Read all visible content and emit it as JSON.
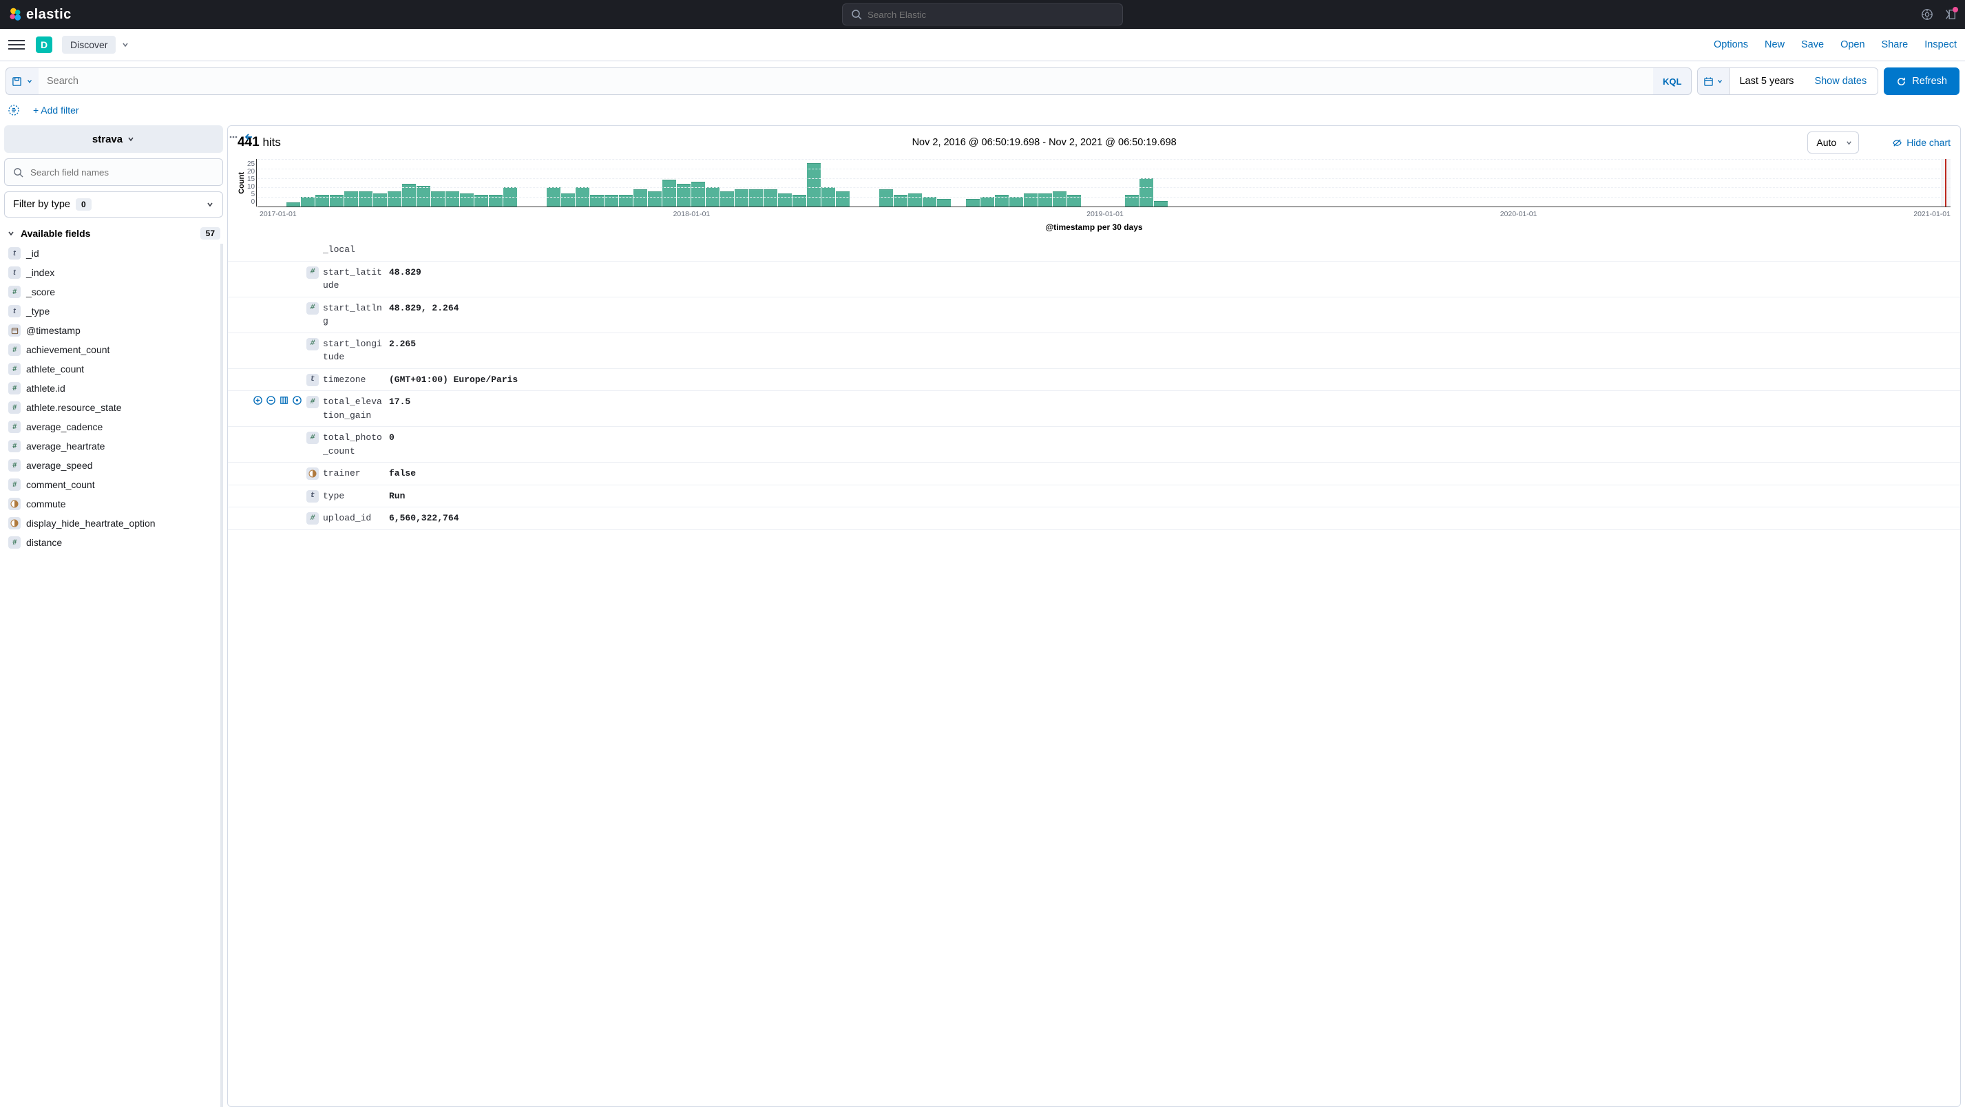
{
  "header": {
    "brand": "elastic",
    "search_placeholder": "Search Elastic"
  },
  "app_bar": {
    "space_letter": "D",
    "app_name": "Discover",
    "actions": [
      "Options",
      "New",
      "Save",
      "Open",
      "Share",
      "Inspect"
    ]
  },
  "query": {
    "search_placeholder": "Search",
    "lang": "KQL",
    "date_text": "Last 5 years",
    "show_dates": "Show dates",
    "refresh": "Refresh"
  },
  "filter_row": {
    "add_filter": "+ Add filter"
  },
  "sidebar": {
    "index_pattern": "strava",
    "field_search_placeholder": "Search field names",
    "filter_by_type": "Filter by type",
    "filter_count": "0",
    "available_fields_label": "Available fields",
    "available_count": "57",
    "fields": [
      {
        "t": "t",
        "n": "_id"
      },
      {
        "t": "t",
        "n": "_index"
      },
      {
        "t": "#",
        "n": "_score"
      },
      {
        "t": "t",
        "n": "_type"
      },
      {
        "t": "d",
        "n": "@timestamp"
      },
      {
        "t": "#",
        "n": "achievement_count"
      },
      {
        "t": "#",
        "n": "athlete_count"
      },
      {
        "t": "#",
        "n": "athlete.id"
      },
      {
        "t": "#",
        "n": "athlete.resource_state"
      },
      {
        "t": "#",
        "n": "average_cadence"
      },
      {
        "t": "#",
        "n": "average_heartrate"
      },
      {
        "t": "#",
        "n": "average_speed"
      },
      {
        "t": "#",
        "n": "comment_count"
      },
      {
        "t": "b",
        "n": "commute"
      },
      {
        "t": "b",
        "n": "display_hide_heartrate_option"
      },
      {
        "t": "#",
        "n": "distance"
      }
    ]
  },
  "hits": {
    "count": "441",
    "label": "hits",
    "range": "Nov 2, 2016 @ 06:50:19.698 - Nov 2, 2021 @ 06:50:19.698",
    "interval": "Auto",
    "hide_chart": "Hide chart"
  },
  "chart_data": {
    "type": "bar",
    "ylabel": "Count",
    "xlabel": "@timestamp per 30 days",
    "ylim": [
      0,
      25
    ],
    "yticks": [
      "25",
      "20",
      "15",
      "10",
      "5",
      "0"
    ],
    "xticks": [
      "2017-01-01",
      "2018-01-01",
      "2019-01-01",
      "2020-01-01",
      "2021-01-01"
    ],
    "values": [
      0,
      0,
      2,
      5,
      6,
      6,
      8,
      8,
      7,
      8,
      12,
      11,
      8,
      8,
      7,
      6,
      6,
      10,
      0,
      0,
      10,
      7,
      10,
      6,
      6,
      6,
      9,
      8,
      14,
      12,
      13,
      10,
      8,
      9,
      9,
      9,
      7,
      6,
      23,
      10,
      8,
      0,
      0,
      9,
      6,
      7,
      5,
      4,
      0,
      4,
      5,
      6,
      5,
      7,
      7,
      8,
      6,
      0,
      0,
      0,
      6,
      15,
      3
    ]
  },
  "doc_rows": [
    {
      "t": "",
      "k": "_local",
      "v": ""
    },
    {
      "t": "#",
      "k": "start_latitude",
      "v": "48.829"
    },
    {
      "t": "#",
      "k": "start_latlng",
      "v": "48.829, 2.264"
    },
    {
      "t": "#",
      "k": "start_longitude",
      "v": "2.265"
    },
    {
      "t": "t",
      "k": "timezone",
      "v": "(GMT+01:00) Europe/Paris"
    },
    {
      "t": "#",
      "k": "total_elevation_gain",
      "v": "17.5",
      "actions": true
    },
    {
      "t": "#",
      "k": "total_photo_count",
      "v": "0"
    },
    {
      "t": "b",
      "k": "trainer",
      "v": "false"
    },
    {
      "t": "t",
      "k": "type",
      "v": "Run"
    },
    {
      "t": "#",
      "k": "upload_id",
      "v": "6,560,322,764"
    }
  ]
}
